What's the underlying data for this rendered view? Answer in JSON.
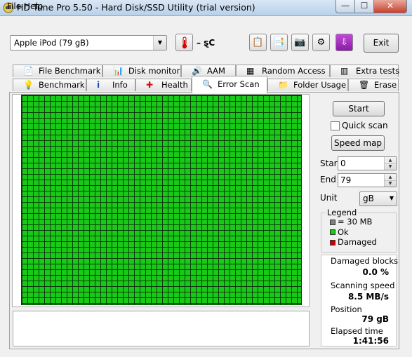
{
  "window": {
    "title": "HD Tune Pro 5.50 - Hard Disk/SSD Utility (trial version)",
    "min_glyph": "—",
    "max_glyph": "☐",
    "close_glyph": "✕"
  },
  "menu": {
    "file": "File",
    "help": "Help"
  },
  "toolbar": {
    "drive": "Apple   iPod (79 gB)",
    "temperature": "– ȿC",
    "exit_label": "Exit"
  },
  "tabs": {
    "row1": [
      "File Benchmark",
      "Disk monitor",
      "AAM",
      "Random Access",
      "Extra tests"
    ],
    "row2": [
      "Benchmark",
      "Info",
      "Health",
      "Error Scan",
      "Folder Usage",
      "Erase"
    ],
    "active": "Error Scan"
  },
  "controls": {
    "start_label": "Start",
    "quick_scan_label": "Quick scan",
    "quick_scan_checked": false,
    "speed_map_label": "Speed map",
    "start_field_label": "Start",
    "start_value": "0",
    "end_field_label": "End",
    "end_value": "79",
    "unit_label": "Unit",
    "unit_value": "gB"
  },
  "legend": {
    "title": "Legend",
    "size": "= 30 MB",
    "ok": "Ok",
    "damaged": "Damaged",
    "colors": {
      "size": "#7f7f7f",
      "ok": "#19c917",
      "damaged": "#d00000"
    }
  },
  "stats": {
    "damaged_blocks_label": "Damaged blocks",
    "damaged_blocks_value": "0.0 %",
    "scanning_speed_label": "Scanning speed",
    "scanning_speed_value": "8.5 MB/s",
    "position_label": "Position",
    "position_value": "79 gB",
    "elapsed_label": "Elapsed time",
    "elapsed_value": "1:41:56"
  },
  "scan_grid": {
    "status": "all blocks ok",
    "color": "#19c917"
  }
}
